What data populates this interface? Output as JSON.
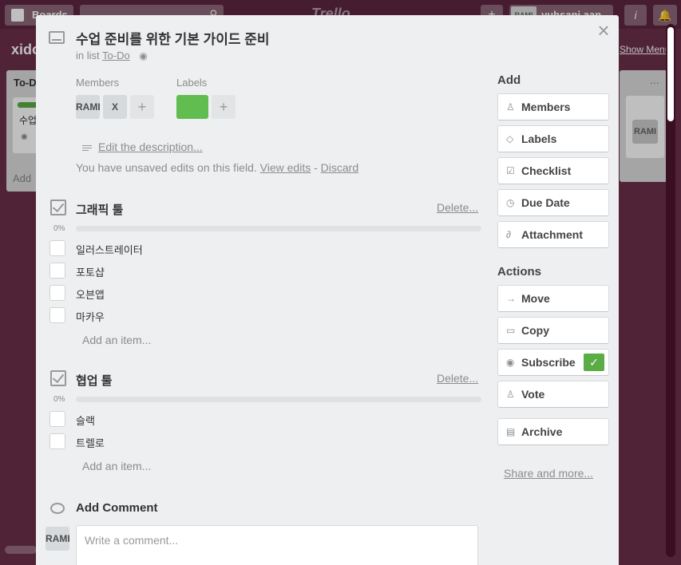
{
  "topbar": {
    "boards_label": "Boards",
    "logo_text": "Trello",
    "add_label": "+",
    "user_initials": "RAMI",
    "user_name": "yuhsanj.aan",
    "info_label": "i"
  },
  "board": {
    "title": "xido",
    "show_menu_label": "Show Menu",
    "left_list": {
      "title": "To-D",
      "card_text": "수업",
      "add_label": "Add"
    },
    "right_list": {
      "menu_label": "...",
      "avatar": "RAMI"
    }
  },
  "card": {
    "title": "수업 준비를 위한 기본 가이드 준비",
    "in_list_prefix": "in list",
    "list_name": "To-Do",
    "close_label": "×",
    "members_label": "Members",
    "labels_label": "Labels",
    "members": [
      "RAMI",
      "X"
    ],
    "add_member_label": "+",
    "add_label_label": "+",
    "label_color": "#61bd4f",
    "edit_description": "Edit the description...",
    "unsaved_text": "You have unsaved edits on this field.",
    "view_edits": "View edits",
    "separator": "-",
    "discard": "Discard"
  },
  "checklists": [
    {
      "title": "그래픽 툴",
      "delete_label": "Delete...",
      "percent": "0%",
      "progress": 0,
      "items": [
        "일러스트레이터",
        "포토샵",
        "오븐앱",
        "마카우"
      ],
      "add_item": "Add an item..."
    },
    {
      "title": "협업 툴",
      "delete_label": "Delete...",
      "percent": "0%",
      "progress": 0,
      "items": [
        "슬랙",
        "트렐로"
      ],
      "add_item": "Add an item..."
    }
  ],
  "comment": {
    "title": "Add Comment",
    "avatar": "RAMI",
    "placeholder": "Write a comment..."
  },
  "sidebar": {
    "add_heading": "Add",
    "add_buttons": [
      {
        "label": "Members",
        "icon": "person-icon"
      },
      {
        "label": "Labels",
        "icon": "tag-icon"
      },
      {
        "label": "Checklist",
        "icon": "checklist-icon"
      },
      {
        "label": "Due Date",
        "icon": "clock-icon"
      },
      {
        "label": "Attachment",
        "icon": "paperclip-icon"
      }
    ],
    "actions_heading": "Actions",
    "action_buttons": [
      {
        "label": "Move",
        "icon": "arrow-right-icon"
      },
      {
        "label": "Copy",
        "icon": "card-icon"
      },
      {
        "label": "Subscribe",
        "icon": "eye-icon"
      },
      {
        "label": "Vote",
        "icon": "thumbs-up-icon"
      },
      {
        "label": "Archive",
        "icon": "archive-icon"
      }
    ],
    "subscribe_check": "✓",
    "share_more": "Share and more..."
  },
  "colors": {
    "board_bg": "#6b2f48",
    "modal_bg": "#edeff0",
    "green": "#5aac44"
  }
}
